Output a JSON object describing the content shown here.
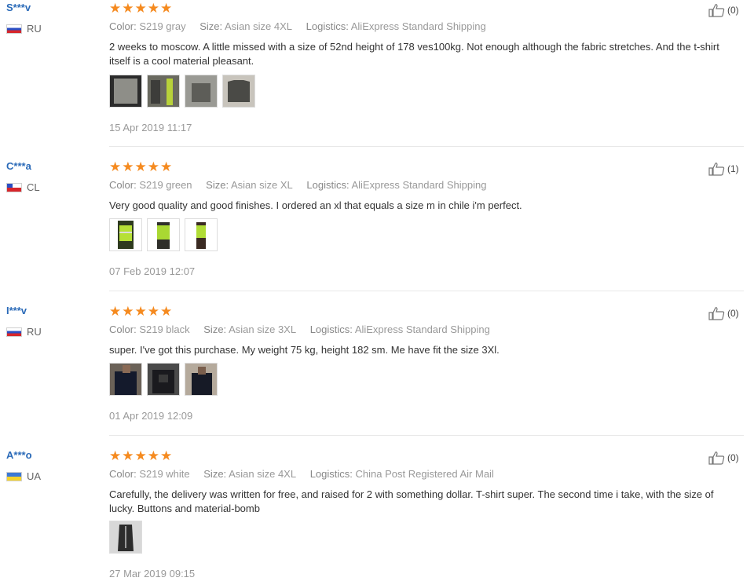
{
  "labels": {
    "color": "Color:",
    "size": "Size:",
    "logistics": "Logistics:"
  },
  "reviews": [
    {
      "user": "S***v",
      "country": "RU",
      "rating": 5,
      "color": "S219 gray",
      "size": "Asian size 4XL",
      "logistics": "AliExpress Standard Shipping",
      "text": "2 weeks to moscow. A little missed with a size of 52nd height of 178 ves100kg. Not enough although the fabric stretches. And the t-shirt itself is a cool material pleasant.",
      "photo_count": 4,
      "date": "15 Apr 2019 11:17",
      "likes": "(0)"
    },
    {
      "user": "C***a",
      "country": "CL",
      "rating": 5,
      "color": "S219 green",
      "size": "Asian size XL",
      "logistics": "AliExpress Standard Shipping",
      "text": "Very good quality and good finishes. I ordered an xl that equals a size m in chile i'm perfect.",
      "photo_count": 3,
      "date": "07 Feb 2019 12:07",
      "likes": "(1)"
    },
    {
      "user": "I***v",
      "country": "RU",
      "rating": 5,
      "color": "S219 black",
      "size": "Asian size 3XL",
      "logistics": "AliExpress Standard Shipping",
      "text": "super. I've got this purchase. My weight 75 kg, height 182 sm. Me have fit the size 3Xl.",
      "photo_count": 3,
      "date": "01 Apr 2019 12:09",
      "likes": "(0)"
    },
    {
      "user": "A***o",
      "country": "UA",
      "rating": 5,
      "color": "S219 white",
      "size": "Asian size 4XL",
      "logistics": "China Post Registered Air Mail",
      "text": "Carefully, the delivery was written for free, and raised for 2 with something dollar. T-shirt super. The second time i take, with the size of lucky. Buttons and material-bomb",
      "photo_count": 1,
      "date": "27 Mar 2019 09:15",
      "likes": "(0)"
    }
  ],
  "colors": {
    "star": "#f58a1f",
    "username": "#2a6ab8",
    "muted": "#999999"
  }
}
